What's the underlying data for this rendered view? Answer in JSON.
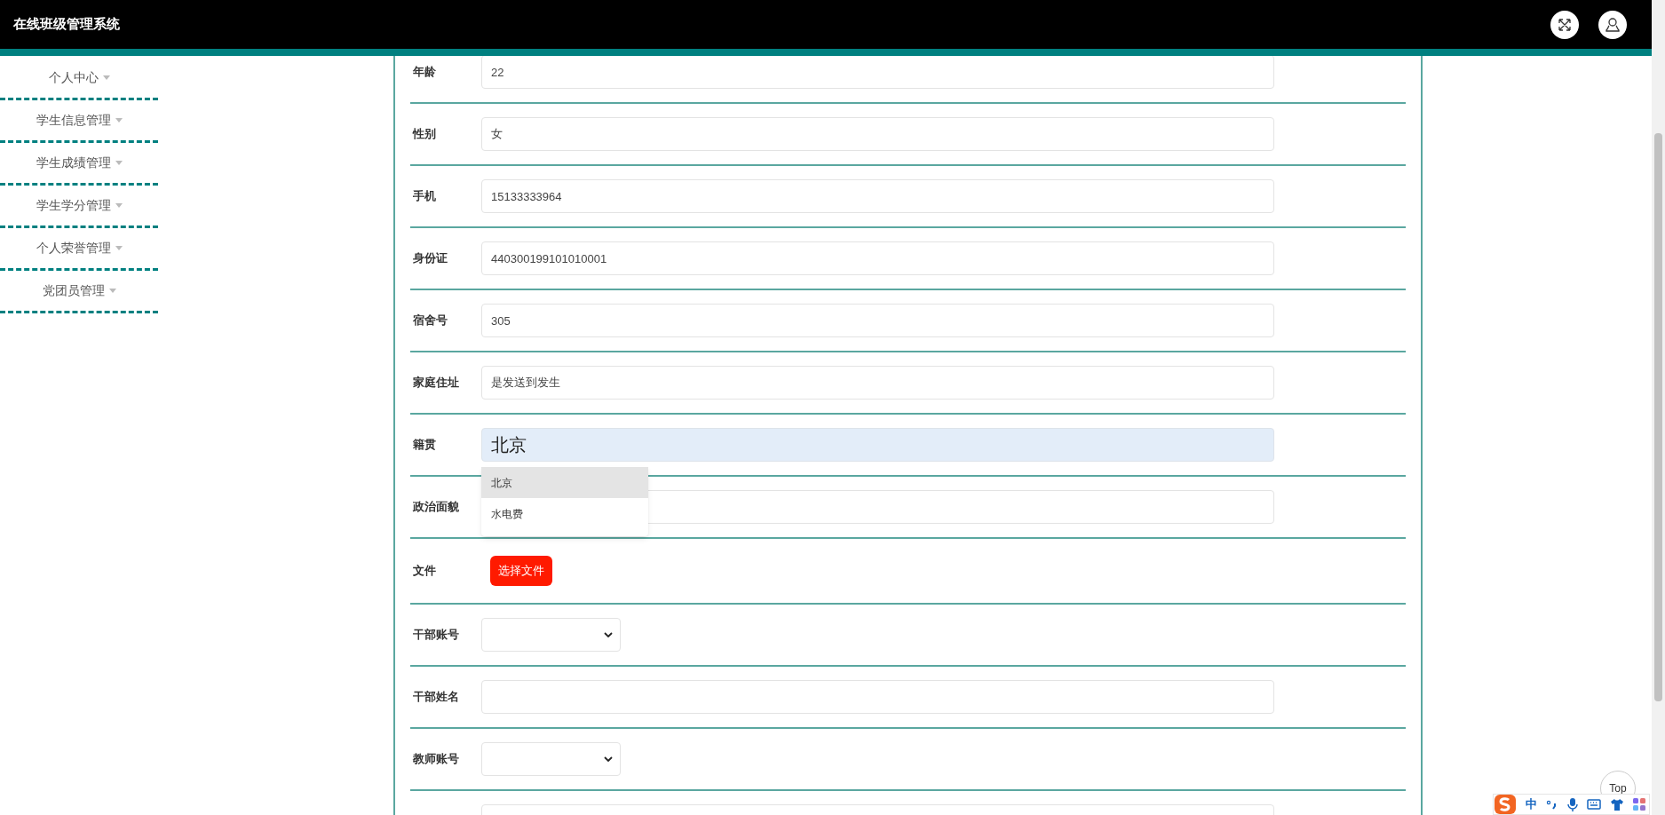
{
  "header": {
    "title": "在线班级管理系统"
  },
  "sidebar": {
    "items": [
      {
        "label": "个人中心"
      },
      {
        "label": "学生信息管理"
      },
      {
        "label": "学生成绩管理"
      },
      {
        "label": "学生学分管理"
      },
      {
        "label": "个人荣誉管理"
      },
      {
        "label": "党团员管理"
      }
    ]
  },
  "form": {
    "rows": [
      {
        "label": "年龄",
        "kind": "text",
        "value": "22",
        "focused": false
      },
      {
        "label": "性别",
        "kind": "text",
        "value": "女",
        "focused": false
      },
      {
        "label": "手机",
        "kind": "text",
        "value": "15133333964",
        "focused": false
      },
      {
        "label": "身份证",
        "kind": "text",
        "value": "440300199101010001",
        "focused": false
      },
      {
        "label": "宿舍号",
        "kind": "text",
        "value": "305",
        "focused": false
      },
      {
        "label": "家庭住址",
        "kind": "text",
        "value": "是发送到发生",
        "focused": false
      },
      {
        "label": "籍贯",
        "kind": "text",
        "value": "北京",
        "focused": true
      },
      {
        "label": "政治面貌",
        "kind": "text",
        "focused": false
      },
      {
        "label": "文件",
        "kind": "file",
        "button": "选择文件"
      },
      {
        "label": "干部账号",
        "kind": "select"
      },
      {
        "label": "干部姓名",
        "kind": "text",
        "focused": false
      },
      {
        "label": "教师账号",
        "kind": "select"
      },
      {
        "kind": "text",
        "focused": false
      }
    ]
  },
  "autocomplete": {
    "options": [
      {
        "label": "北京",
        "selected": true
      },
      {
        "label": "水电费",
        "selected": false
      }
    ]
  },
  "top_button": {
    "label": "Top"
  },
  "ime_toolbar": {
    "mode": "中"
  }
}
